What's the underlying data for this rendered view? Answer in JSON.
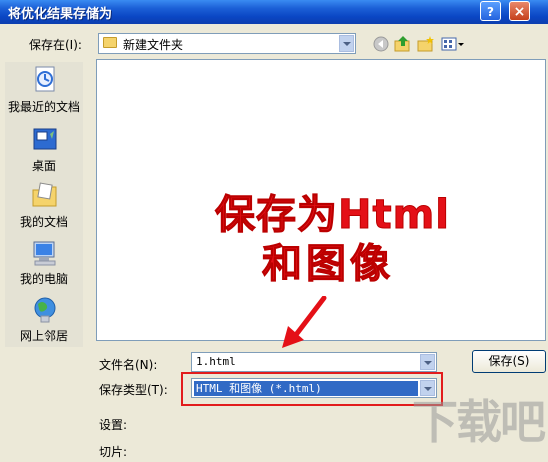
{
  "window": {
    "title": "将优化结果存储为",
    "help_label": "?",
    "close_label": "×"
  },
  "save_in": {
    "label": "保存在(I):",
    "value": "新建文件夹"
  },
  "toolbar": {
    "icons": [
      "back-icon",
      "up-folder-icon",
      "new-folder-icon",
      "views-menu-icon"
    ]
  },
  "places": [
    {
      "label": "我最近的文档",
      "icon": "recent-documents-icon"
    },
    {
      "label": "桌面",
      "icon": "desktop-icon"
    },
    {
      "label": "我的文档",
      "icon": "my-documents-icon"
    },
    {
      "label": "我的电脑",
      "icon": "my-computer-icon"
    },
    {
      "label": "网上邻居",
      "icon": "network-places-icon"
    }
  ],
  "annotation": {
    "line1": "保存为Html",
    "line2": "和图像"
  },
  "filename": {
    "label": "文件名(N):",
    "value": "1.html"
  },
  "filetype": {
    "label": "保存类型(T):",
    "value": "HTML 和图像 (*.html)"
  },
  "save_button": {
    "label": "保存(S)"
  },
  "settings": {
    "label": "设置:"
  },
  "slices": {
    "label": "切片:"
  },
  "watermark": {
    "text": "下载吧"
  },
  "colors": {
    "annotation": "#e41017",
    "highlight_border": "#e21c1c",
    "selection": "#316ac5"
  }
}
